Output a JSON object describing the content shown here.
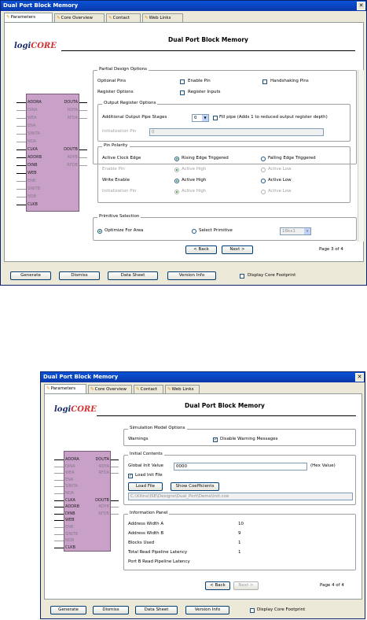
{
  "window1": {
    "title": "Dual Port Block Memory",
    "tabs": [
      "Parameters",
      "Core Overview",
      "Contact",
      "Web Links"
    ],
    "logo": {
      "left": "logi",
      "right": "CORE"
    },
    "header": "Dual Port Block Memory",
    "symbol": {
      "pins_left": [
        "ADDRA",
        "DINA",
        "WEA",
        "ENA",
        "SINITA",
        "NDA",
        "CLKA",
        "ADDRB",
        "DINB",
        "WEB",
        "ENB",
        "SINITB",
        "NDB",
        "CLKB"
      ],
      "pins_right": [
        "DOUTA",
        "RDYA",
        "RFDA",
        "DOUTB",
        "RDYB",
        "RFDB"
      ]
    },
    "partial_design": {
      "legend": "Partial Design Options",
      "optional_pins": "Optional Pins",
      "enable_pin": "Enable Pin",
      "handshaking_pins": "Handshaking Pins",
      "register_options": "Register Options",
      "register_inputs": "Register Inputs"
    },
    "output_register": {
      "legend": "Output Register Options",
      "additional_label": "Additional Output Pipe Stages",
      "pipe_value": "0",
      "fill_pipe_label": "Fill pipe (Adds 1 to reduced output register depth)",
      "init_label": "Initialization Pin",
      "init_value": "0"
    },
    "pin_polarity": {
      "legend": "Pin Polarity",
      "rows": [
        {
          "label": "Active Clock Edge",
          "a": "Rising Edge Triggered",
          "b": "Falling Edge Triggered"
        },
        {
          "label": "Enable Pin",
          "a": "Active High",
          "b": "Active Low"
        },
        {
          "label": "Write Enable",
          "a": "Active High",
          "b": "Active Low"
        },
        {
          "label": "Initialization Pin",
          "a": "Active High",
          "b": "Active Low"
        }
      ]
    },
    "primitive": {
      "legend": "Primitive Selection",
      "optimize": "Optimize For Area",
      "select": "Select Primitive",
      "select_value": "16kx1"
    },
    "nav": {
      "back": "< Back",
      "next": "Next >",
      "page": "Page 3 of 4"
    },
    "bottom": {
      "generate": "Generate",
      "dismiss": "Dismiss",
      "datasheet": "Data Sheet",
      "version": "Version Info",
      "footprint": "Display Core Footprint"
    }
  },
  "window2": {
    "title": "Dual Port Block Memory",
    "tabs": [
      "Parameters",
      "Core Overview",
      "Contact",
      "Web Links"
    ],
    "logo": {
      "left": "logi",
      "right": "CORE"
    },
    "header": "Dual Port Block Memory",
    "symbol": {
      "pins_left": [
        "ADDRA",
        "DINA",
        "WEA",
        "ENA",
        "SINITA",
        "NDA",
        "CLKA",
        "ADDRB",
        "DINB",
        "WEB",
        "ENB",
        "SINITB",
        "NDB",
        "CLKB"
      ],
      "pins_right": [
        "DOUTA",
        "RDYA",
        "RFDA",
        "DOUTB",
        "RDYB",
        "RFDB"
      ]
    },
    "simulation": {
      "legend": "Simulation Model Options",
      "warnings_label": "Warnings",
      "disable_label": "Disable Warning Messages"
    },
    "init_contents": {
      "legend": "Initial Contents",
      "global_label": "Global Init Value",
      "global_value": "0000",
      "global_suffix": "(Hex Value)",
      "load_label": "Load Init File",
      "load_btn": "Load File",
      "show_btn": "Show Coefficients",
      "path": "C:\\Xilinx\\ISE\\Designs\\Dual_Port\\Demo\\Init.coe"
    },
    "info": {
      "legend": "Information Panel",
      "rows": [
        {
          "label": "Address Width A",
          "value": "10"
        },
        {
          "label": "Address Width B",
          "value": "9"
        },
        {
          "label": "Blocks Used",
          "value": "1"
        },
        {
          "label": "Total Read Pipeline Latency",
          "value": "1"
        },
        {
          "label": "Port B Read Pipeline Latency",
          "value": ""
        }
      ]
    },
    "nav": {
      "back": "< Back",
      "next": "Next >",
      "page": "Page 4 of 4"
    },
    "bottom": {
      "generate": "Generate",
      "dismiss": "Dismiss",
      "datasheet": "Data Sheet",
      "version": "Version Info",
      "footprint": "Display Core Footprint"
    }
  },
  "colors": {
    "titlebar": "#0a46c8",
    "symbol_fill": "#c8a0c8",
    "face": "#ece9d8",
    "accent": "#e08a00"
  }
}
